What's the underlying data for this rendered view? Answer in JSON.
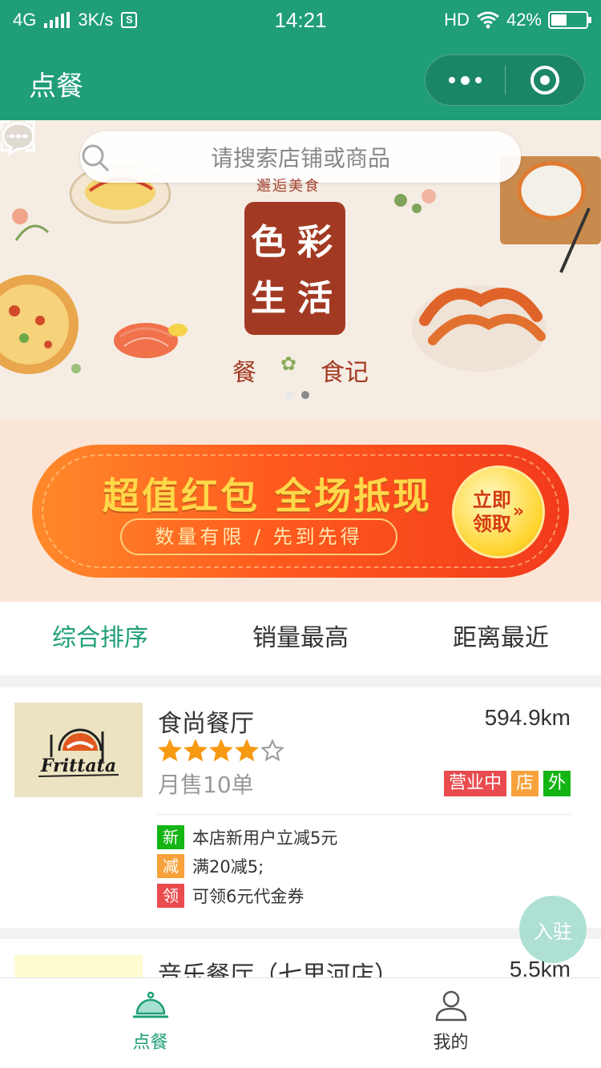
{
  "status_bar": {
    "network": "4G",
    "speed": "3K/s",
    "speed_icon": "S",
    "time": "14:21",
    "hd": "HD",
    "battery": "42%",
    "battery_level": 0.42
  },
  "nav": {
    "title": "点餐"
  },
  "banner": {
    "search_placeholder": "请搜索店铺或商品",
    "brand_subtitle": "邂逅美食",
    "brand_chars": [
      "色",
      "彩",
      "生",
      "活"
    ],
    "brand_footer_left": "餐",
    "brand_footer_right": "食记",
    "carousel_active_index": 1
  },
  "promo": {
    "title": "超值红包 全场抵现",
    "subtitle": "数量有限 / 先到先得",
    "button_line1": "立即",
    "button_line2": "领取",
    "button_arrow": "»"
  },
  "sort_tabs": [
    {
      "label": "综合排序",
      "active": true
    },
    {
      "label": "销量最高",
      "active": false
    },
    {
      "label": "距离最近",
      "active": false
    }
  ],
  "shops": [
    {
      "logo_text": "Frittata",
      "name": "食尚餐厅",
      "distance": "594.9km",
      "rating": 4,
      "rating_max": 5,
      "monthly_sales": "月售10单",
      "tags": [
        {
          "label": "营业中",
          "color": "#e94b4f"
        },
        {
          "label": "店",
          "color": "#f7a23b"
        },
        {
          "label": "外",
          "color": "#14b514"
        }
      ],
      "promotions": [
        {
          "badge": "新",
          "color": "#14b514",
          "text": "本店新用户立减5元"
        },
        {
          "badge": "减",
          "color": "#f7a23b",
          "text": "满20减5;"
        },
        {
          "badge": "领",
          "color": "#e94b4f",
          "text": "可领6元代金券"
        }
      ]
    },
    {
      "name": "音乐餐厅（七里河店）",
      "distance": "5.5km"
    }
  ],
  "join_button": "入驻",
  "tab_bar": [
    {
      "label": "点餐",
      "icon": "cloche-icon",
      "active": true
    },
    {
      "label": "我的",
      "icon": "user-icon",
      "active": false
    }
  ],
  "colors": {
    "brand_green": "#1f9e78",
    "promo_orange": "#ff5a1e",
    "banner_brand_red": "#a23a23"
  }
}
